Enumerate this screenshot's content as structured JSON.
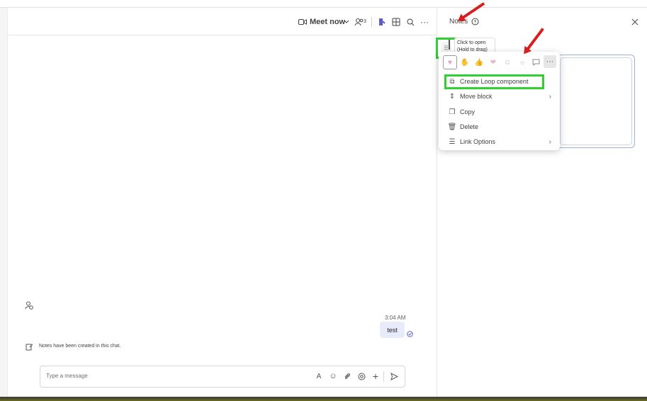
{
  "toolbar": {
    "meet_now_label": "Meet now",
    "participants_count": "3"
  },
  "notes": {
    "title": "Notes",
    "drag_tooltip_line1": "Click to open",
    "drag_tooltip_line2": "(Hold to drag)"
  },
  "context_menu": {
    "items": [
      {
        "label": "Create Loop component",
        "icon": "loop-icon"
      },
      {
        "label": "Move block",
        "icon": "move-icon"
      },
      {
        "label": "Copy",
        "icon": "copy-icon"
      },
      {
        "label": "Delete",
        "icon": "trash-icon"
      },
      {
        "label": "Link Options",
        "icon": "sliders-icon"
      }
    ]
  },
  "chat": {
    "timestamp": "3:04 AM",
    "message_text": "test",
    "system_message": "Notes have been created in this chat."
  },
  "composer": {
    "placeholder": "Type a message"
  },
  "colors": {
    "highlight": "#2fd02f",
    "annotation_arrow": "#d71f1f",
    "message_bubble": "#e8ebfa"
  }
}
